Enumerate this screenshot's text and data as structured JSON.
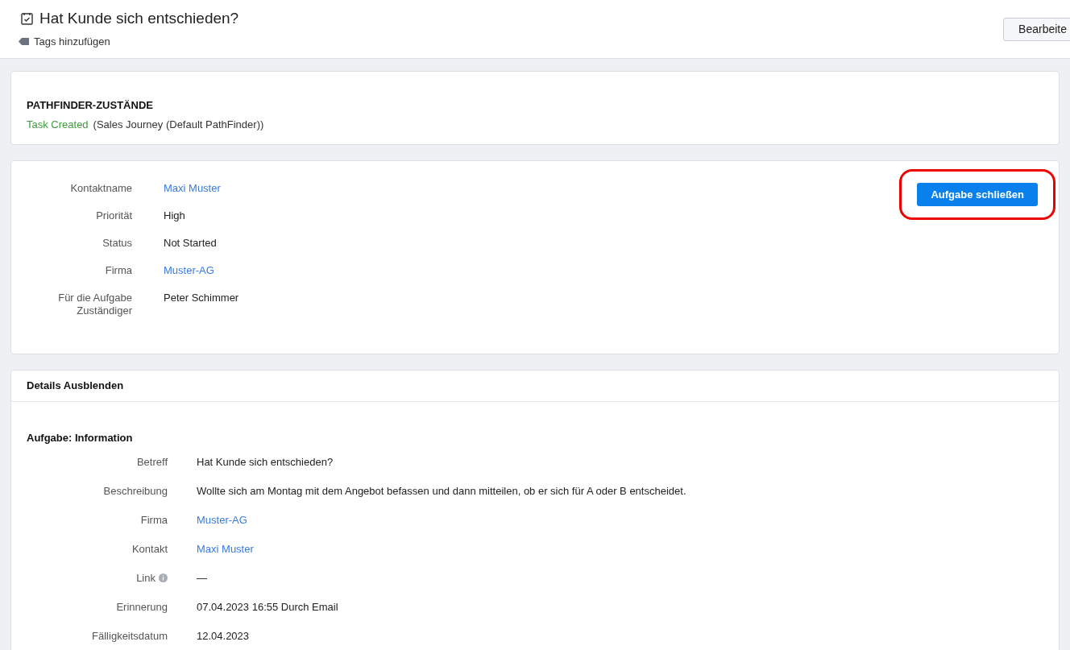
{
  "header": {
    "title": "Hat Kunde sich entschieden?",
    "tags_link": "Tags hinzufügen",
    "edit_button": "Bearbeite"
  },
  "pathfinder": {
    "title": "PATHFINDER-ZUSTÄNDE",
    "state": "Task Created",
    "journey": "(Sales Journey (Default PathFinder))"
  },
  "summary": {
    "fields": [
      {
        "label": "Kontaktname",
        "value": "Maxi Muster",
        "kind": "link"
      },
      {
        "label": "Priorität",
        "value": "High",
        "kind": "text"
      },
      {
        "label": "Status",
        "value": "Not Started",
        "kind": "text"
      },
      {
        "label": "Firma",
        "value": "Muster-AG",
        "kind": "link"
      },
      {
        "label": "Für die Aufgabe Zuständiger",
        "value": "Peter Schimmer",
        "kind": "text"
      }
    ],
    "close_button": "Aufgabe schließen",
    "highlighted": true
  },
  "details": {
    "toggle": "Details Ausblenden",
    "section_title": "Aufgabe: Information",
    "fields": [
      {
        "label": "Betreff",
        "value": "Hat Kunde sich entschieden?",
        "kind": "text",
        "info": false
      },
      {
        "label": "Beschreibung",
        "value": "Wollte sich am Montag mit dem Angebot befassen und dann mitteilen, ob er sich für A oder B entscheidet.",
        "kind": "text",
        "info": false
      },
      {
        "label": "Firma",
        "value": "Muster-AG",
        "kind": "link",
        "info": false
      },
      {
        "label": "Kontakt",
        "value": "Maxi Muster",
        "kind": "link",
        "info": false
      },
      {
        "label": "Link",
        "value": "—",
        "kind": "text",
        "info": true
      },
      {
        "label": "Erinnerung",
        "value": "07.04.2023 16:55 Durch Email",
        "kind": "text",
        "info": false
      },
      {
        "label": "Fälligkeitsdatum",
        "value": "12.04.2023",
        "kind": "text",
        "info": false
      }
    ]
  }
}
